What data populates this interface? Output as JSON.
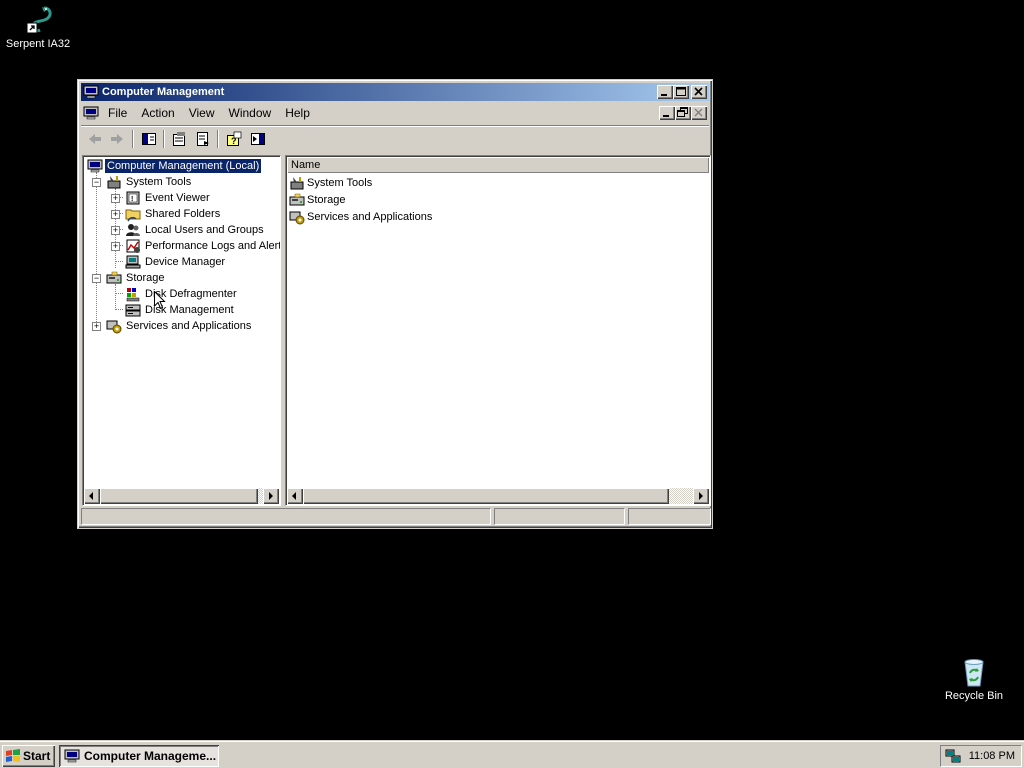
{
  "desktop": {
    "icons": [
      {
        "label": "Serpent IA32"
      },
      {
        "label": "Recycle Bin"
      }
    ]
  },
  "window": {
    "title": "Computer Management",
    "menu": [
      "File",
      "Action",
      "View",
      "Window",
      "Help"
    ],
    "tree": {
      "root": "Computer Management (Local)",
      "items": [
        {
          "label": "System Tools"
        },
        {
          "label": "Event Viewer"
        },
        {
          "label": "Shared Folders"
        },
        {
          "label": "Local Users and Groups"
        },
        {
          "label": "Performance Logs and Alerts"
        },
        {
          "label": "Device Manager"
        },
        {
          "label": "Storage"
        },
        {
          "label": "Disk Defragmenter"
        },
        {
          "label": "Disk Management"
        },
        {
          "label": "Services and Applications"
        }
      ]
    },
    "list": {
      "column": "Name",
      "rows": [
        "System Tools",
        "Storage",
        "Services and Applications"
      ]
    }
  },
  "taskbar": {
    "start_label": "Start",
    "task_label": "Computer Manageme...",
    "clock": "11:08 PM"
  },
  "colors": {
    "title_active": "#0a246a",
    "title_gradient_end": "#a6caf0",
    "face": "#d4d0c8",
    "desktop": "#000000"
  }
}
